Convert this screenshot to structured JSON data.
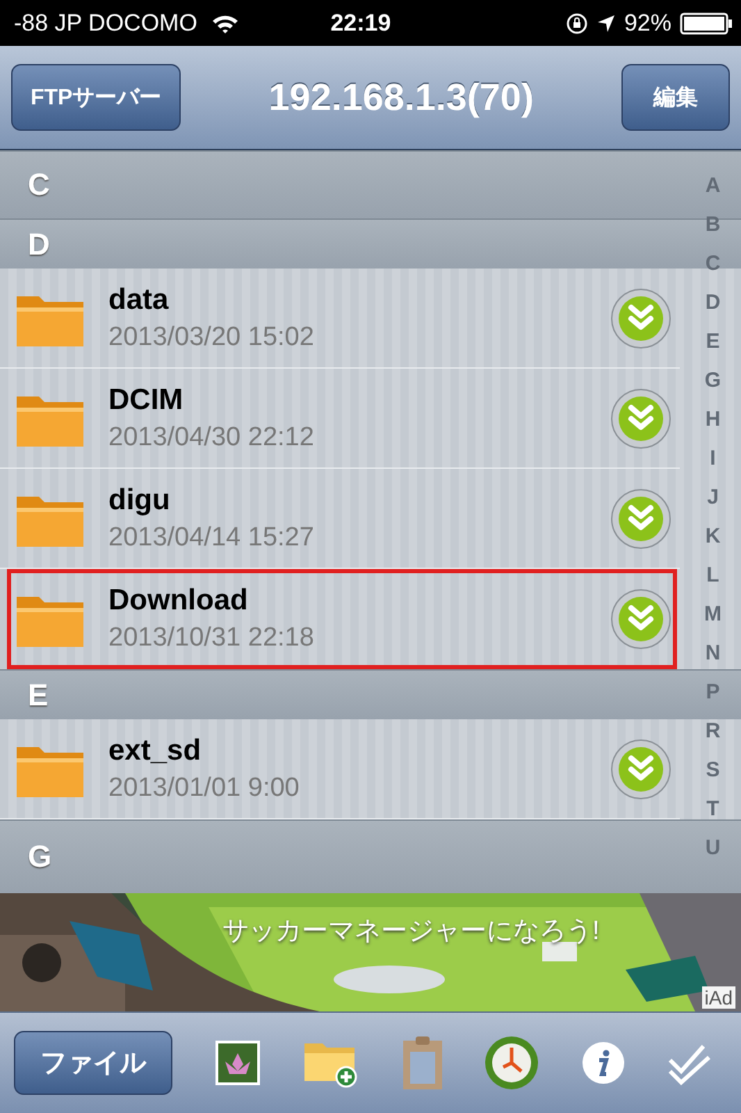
{
  "status_bar": {
    "carrier": "-88 JP DOCOMO",
    "time": "22:19",
    "battery": "92%"
  },
  "nav_bar": {
    "back_button": "FTPサーバー",
    "title": "192.168.1.3(70)",
    "edit_button": "編集"
  },
  "list": [
    {
      "kind": "header",
      "letter": "C"
    },
    {
      "kind": "header",
      "letter": "D"
    },
    {
      "kind": "folder",
      "name": "data",
      "date": "2013/03/20 15:02",
      "selected": false
    },
    {
      "kind": "folder",
      "name": "DCIM",
      "date": "2013/04/30 22:12",
      "selected": false
    },
    {
      "kind": "folder",
      "name": "digu",
      "date": "2013/04/14 15:27",
      "selected": false
    },
    {
      "kind": "folder",
      "name": "Download",
      "date": "2013/10/31 22:18",
      "selected": true
    },
    {
      "kind": "header",
      "letter": "E"
    },
    {
      "kind": "folder",
      "name": "ext_sd",
      "date": "2013/01/01 9:00",
      "selected": false
    },
    {
      "kind": "header",
      "letter": "G"
    }
  ],
  "index": [
    "A",
    "B",
    "C",
    "D",
    "E",
    "G",
    "H",
    "I",
    "J",
    "K",
    "L",
    "M",
    "N",
    "P",
    "R",
    "S",
    "T",
    "U"
  ],
  "ad": {
    "kind": "picture",
    "headline": "サッカーマネージャーになろう!",
    "badge": "iAd"
  },
  "toolbar": {
    "file_button": "ファイル"
  }
}
